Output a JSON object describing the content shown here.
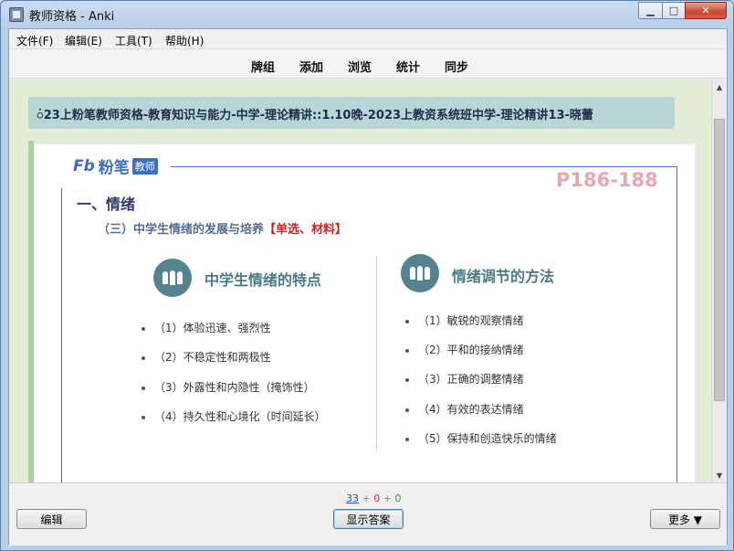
{
  "window": {
    "title": "教师资格 - Anki"
  },
  "menu": [
    "文件(F)",
    "编辑(E)",
    "工具(T)",
    "帮助(H)"
  ],
  "toolbar": [
    "牌组",
    "添加",
    "浏览",
    "统计",
    "同步"
  ],
  "deck_path": "ꩌ23上粉笔教师资格-教育知识与能力-中学-理论精讲::1.10晚-2023上教资系统班中学-理论精讲13-晓蕾",
  "card": {
    "logo_text": "粉笔",
    "logo_badge": "教师",
    "page_ref": "P186-188",
    "section_title": "一、情绪",
    "subtitle": "（三）中学生情绪的发展与培养",
    "subtitle_tag": "【单选、材料】",
    "left_title": "中学生情绪的特点",
    "left_items": [
      "（1）体验迅速、强烈性",
      "（2）不稳定性和两极性",
      "（3）外露性和内隐性（掩饰性）",
      "（4）持久性和心境化（时间延长）"
    ],
    "right_title": "情绪调节的方法",
    "right_items": [
      "（1）敏锐的观察情绪",
      "（2）平和的接纳情绪",
      "（3）正确的调整情绪",
      "（4）有效的表达情绪",
      "（5）保持和创造快乐的情绪"
    ]
  },
  "counts": {
    "new": "33",
    "learn": "0",
    "review": "0"
  },
  "buttons": {
    "edit": "编辑",
    "show_answer": "显示答案",
    "more": "更多 ▼"
  }
}
